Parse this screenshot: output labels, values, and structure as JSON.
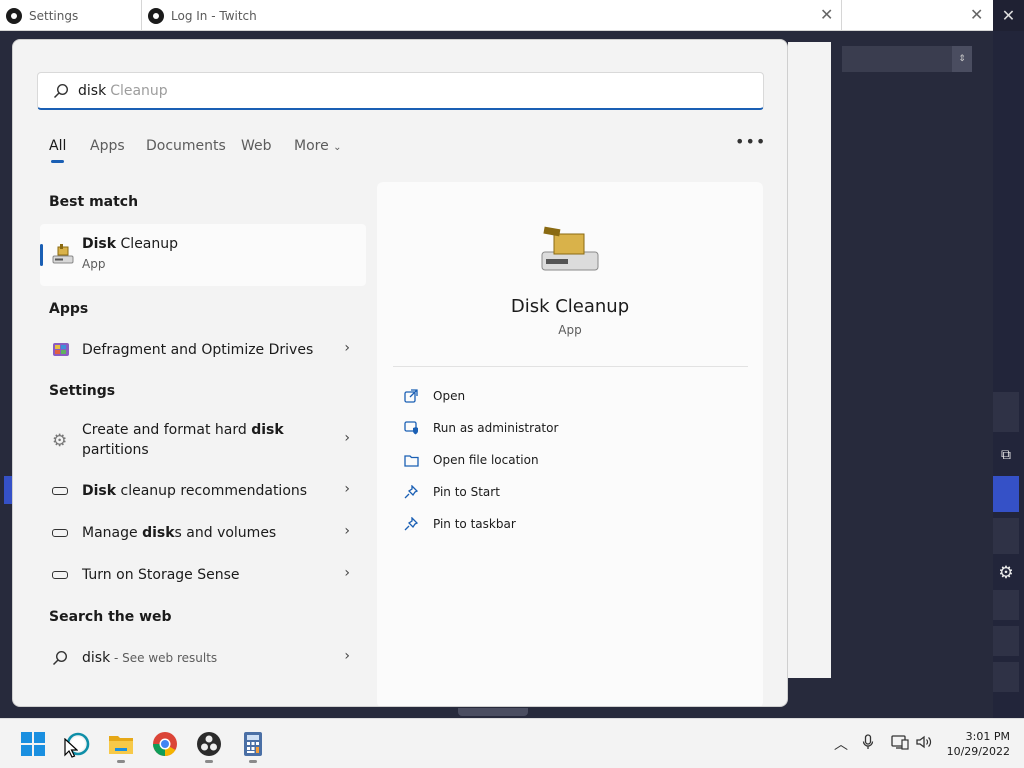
{
  "background": {
    "tabs": [
      {
        "label": "Settings"
      },
      {
        "label": "Log In - Twitch"
      }
    ]
  },
  "search": {
    "typed": "disk",
    "suggestion": "Cleanup",
    "filters": [
      "All",
      "Apps",
      "Documents",
      "Web",
      "More"
    ],
    "active_filter": "All"
  },
  "results": {
    "best_match_header": "Best match",
    "best_match": {
      "name_bold": "Disk",
      "name_rest": " Cleanup",
      "type": "App"
    },
    "apps_header": "Apps",
    "apps": [
      {
        "label": "Defragment and Optimize Drives"
      }
    ],
    "settings_header": "Settings",
    "settings": [
      {
        "pre": "Create and format hard ",
        "bold": "disk",
        "post": "",
        "line2": "partitions"
      },
      {
        "pre": "",
        "bold": "Disk",
        "post": " cleanup recommendations"
      },
      {
        "pre": "Manage ",
        "bold": "disk",
        "post": "s and volumes"
      },
      {
        "pre": "Turn on Storage Sense",
        "bold": "",
        "post": ""
      }
    ],
    "web_header": "Search the web",
    "web": {
      "query": "disk",
      "suffix": " - See web results"
    }
  },
  "preview": {
    "name": "Disk Cleanup",
    "type": "App",
    "actions": [
      {
        "label": "Open",
        "icon": "open-external-icon"
      },
      {
        "label": "Run as administrator",
        "icon": "shield-admin-icon"
      },
      {
        "label": "Open file location",
        "icon": "folder-icon"
      },
      {
        "label": "Pin to Start",
        "icon": "pin-icon"
      },
      {
        "label": "Pin to taskbar",
        "icon": "pin-icon"
      }
    ]
  },
  "taskbar": {
    "apps": [
      "start-icon",
      "search-icon",
      "file-explorer-icon",
      "chrome-icon",
      "obs-icon",
      "calculator-icon"
    ],
    "time": "3:01 PM",
    "date": "10/29/2022"
  },
  "colors": {
    "accent": "#1a5fb4",
    "panel": "#f3f3f3",
    "desktop_dark": "#272a3c"
  }
}
